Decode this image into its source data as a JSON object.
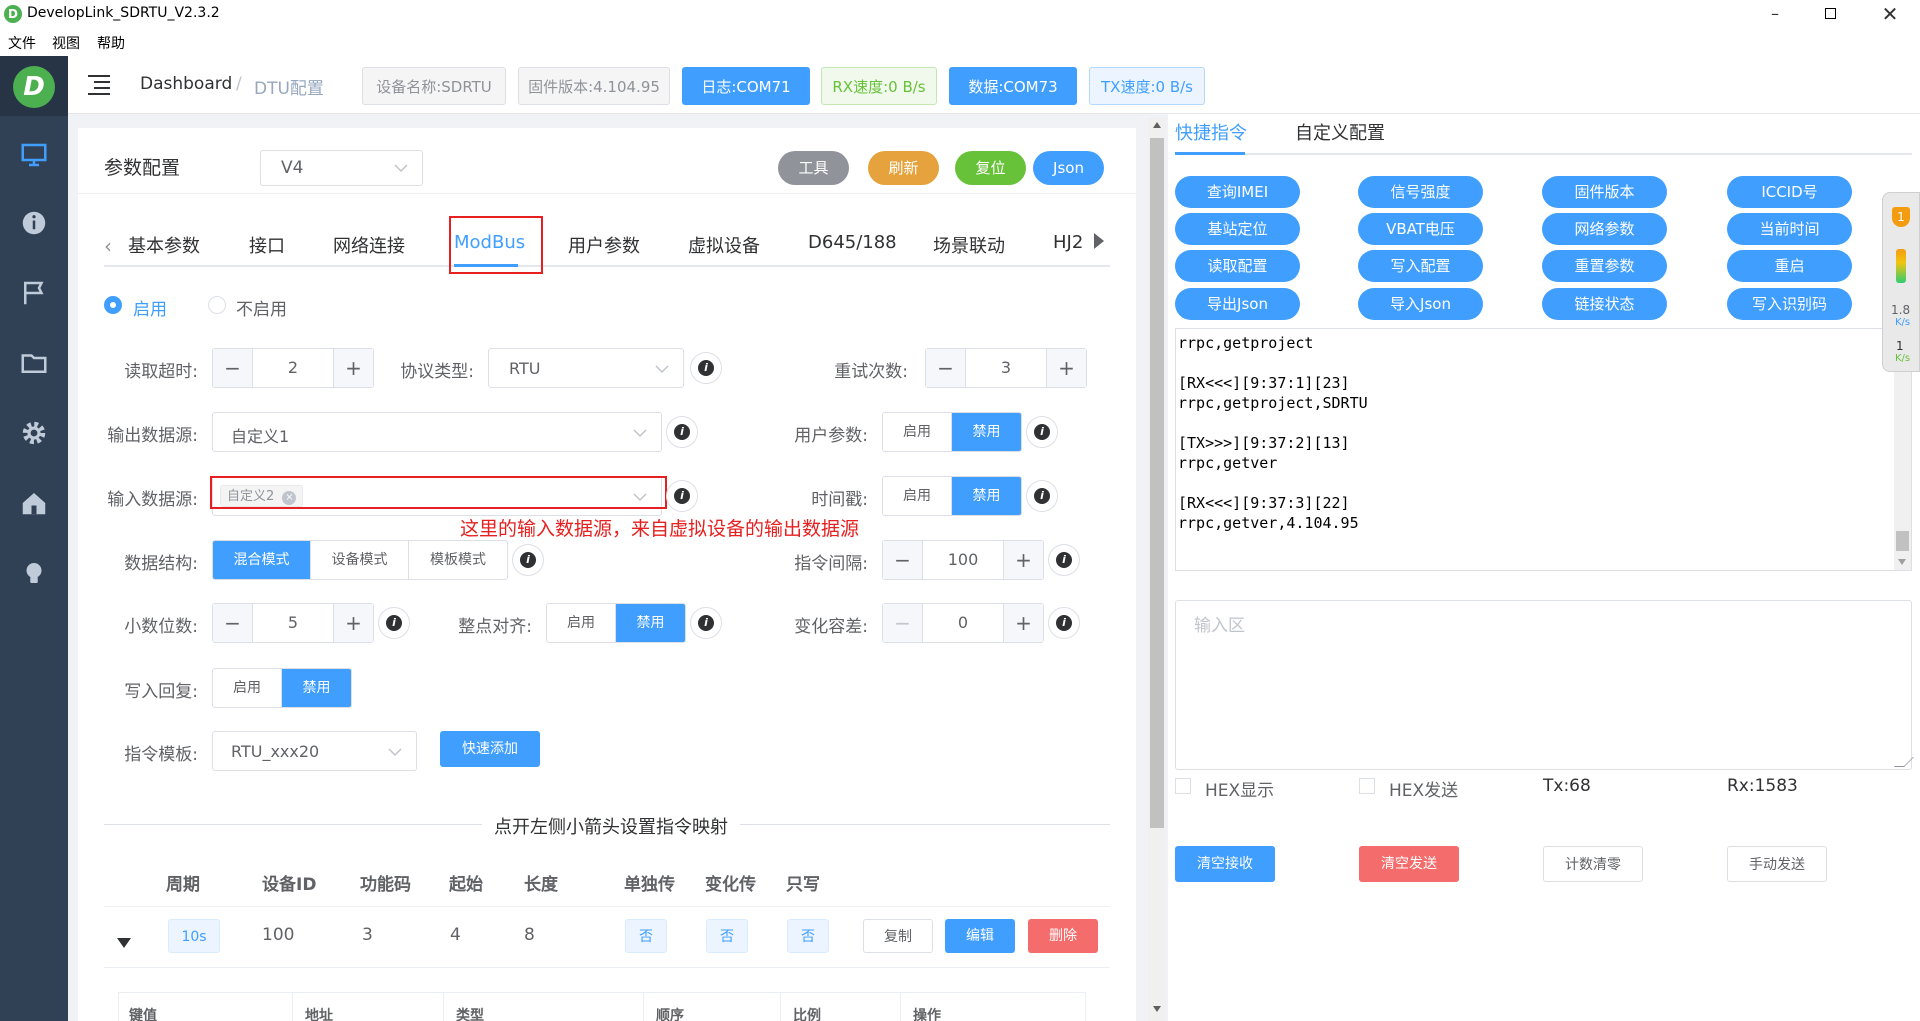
{
  "window": {
    "title": "DevelopLink_SDRTU_V2.3.2"
  },
  "menu": [
    "文件",
    "视图",
    "帮助"
  ],
  "header": {
    "breadcrumb_home": "Dashboard",
    "breadcrumb_sep": "/",
    "breadcrumb_current": "DTU配置",
    "device_name": "设备名称:SDRTU",
    "firmware": "固件版本:4.104.95",
    "log_port": "日志:COM71",
    "rx_speed": "RX速度:0 B/s",
    "data_port": "数据:COM73",
    "tx_speed": "TX速度:0 B/s"
  },
  "params": {
    "title": "参数配置",
    "version": "V4",
    "btn_tool": "工具",
    "btn_refresh": "刷新",
    "btn_reset": "复位",
    "btn_json": "Json"
  },
  "tabs": [
    "基本参数",
    "接口",
    "网络连接",
    "ModBus",
    "用户参数",
    "虚拟设备",
    "D645/188",
    "场景联动",
    "HJ2"
  ],
  "active_tab": "ModBus",
  "enable": {
    "on": "启用",
    "off": "不启用",
    "selected": "启用"
  },
  "form": {
    "read_timeout_label": "读取超时:",
    "read_timeout": "2",
    "protocol_label": "协议类型:",
    "protocol": "RTU",
    "retry_label": "重试次数:",
    "retry": "3",
    "output_src_label": "输出数据源:",
    "output_src": "自定义1",
    "user_param_label": "用户参数:",
    "input_src_label": "输入数据源:",
    "input_src_tag": "自定义2",
    "timestamp_label": "时间戳:",
    "annotation": "这里的输入数据源，来自虚拟设备的输出数据源",
    "struct_label": "数据结构:",
    "struct_opts": [
      "混合模式",
      "设备模式",
      "模板模式"
    ],
    "cmd_interval_label": "指令间隔:",
    "cmd_interval": "100",
    "decimal_label": "小数位数:",
    "decimal": "5",
    "align_label": "整点对齐:",
    "tolerance_label": "变化容差:",
    "tolerance": "0",
    "write_reply_label": "写入回复:",
    "template_label": "指令模板:",
    "template": "RTU_xxx20",
    "quick_add": "快速添加",
    "on": "启用",
    "off": "禁用",
    "divider_text": "点开左侧小箭头设置指令映射"
  },
  "table": {
    "headers": [
      "周期",
      "设备ID",
      "功能码",
      "起始",
      "长度",
      "单独传",
      "变化传",
      "只写"
    ],
    "row": {
      "period": "10s",
      "device_id": "100",
      "func": "3",
      "start": "4",
      "length": "8",
      "single": "否",
      "change": "否",
      "write_only": "否"
    },
    "btn_copy": "复制",
    "btn_edit": "编辑",
    "btn_delete": "删除",
    "sub_headers": [
      "键值",
      "地址",
      "类型",
      "顺序",
      "比例",
      "操作"
    ]
  },
  "right": {
    "tab_quick": "快捷指令",
    "tab_custom": "自定义配置",
    "quick_cmds": [
      "查询IMEI",
      "信号强度",
      "固件版本",
      "ICCID号",
      "基站定位",
      "VBAT电压",
      "网络参数",
      "当前时间",
      "读取配置",
      "写入配置",
      "重置参数",
      "重启",
      "导出Json",
      "导入Json",
      "链接状态",
      "写入识别码"
    ],
    "log_lines": [
      "rrpc,getproject",
      "",
      "[RX<<<][9:37:1][23]",
      "rrpc,getproject,SDRTU",
      "",
      "[TX>>>][9:37:2][13]",
      "rrpc,getver",
      "",
      "[RX<<<][9:37:3][22]",
      "rrpc,getver,4.104.95"
    ],
    "input_placeholder": "输入区",
    "hex_show": "HEX显示",
    "hex_send": "HEX发送",
    "tx": "Tx:68",
    "rx": "Rx:1583",
    "btn_clear_rx": "清空接收",
    "btn_clear_tx": "清空发送",
    "btn_count_reset": "计数清零",
    "btn_manual_send": "手动发送"
  },
  "float_widget": {
    "badge": "1",
    "speed_value": "1.8",
    "up": "K/s",
    "mid": "1",
    "down": "K/s"
  },
  "colors": {
    "primary": "#409eff",
    "sidebar": "#304156",
    "danger": "#f56c6c",
    "warning": "#e6a23c",
    "success": "#67c23a",
    "info": "#909399",
    "annotation": "#e62020"
  }
}
